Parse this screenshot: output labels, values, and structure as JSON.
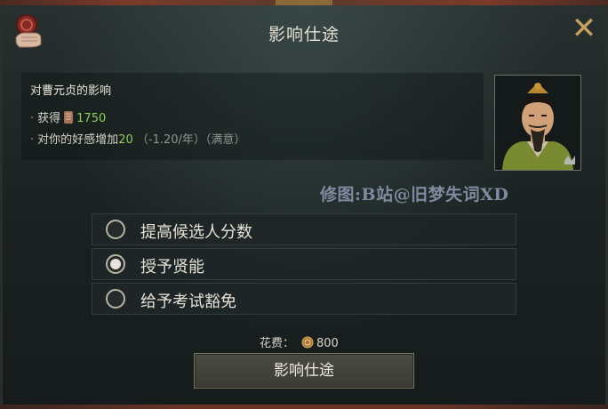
{
  "dialog": {
    "title": "影响仕途",
    "close_icon": "close-icon",
    "seal_icon": "hand-seal-icon"
  },
  "influence": {
    "prefix": "对",
    "person_name": "曹元贞",
    "suffix": "的影响",
    "gain_label": "获得",
    "gain_icon": "scroll-icon",
    "gain_value": "1750",
    "opinion_prefix": "对",
    "opinion_you": "你",
    "opinion_mid": "的好感增加",
    "opinion_value": "20",
    "opinion_rate": "（-1.20/年）",
    "opinion_status": "（满意）"
  },
  "watermark": "修图:B站@旧梦失词XD",
  "options": [
    {
      "label": "提高候选人分数",
      "selected": false
    },
    {
      "label": "授予贤能",
      "selected": true
    },
    {
      "label": "给予考试豁免",
      "selected": false
    }
  ],
  "cost": {
    "label": "花费：",
    "icon": "coin-icon",
    "value": "800"
  },
  "action_button": {
    "label": "影响仕途"
  },
  "colors": {
    "accent_gold": "#c8a060",
    "positive_green": "#8ccc5a",
    "text": "#e6e2d6"
  }
}
